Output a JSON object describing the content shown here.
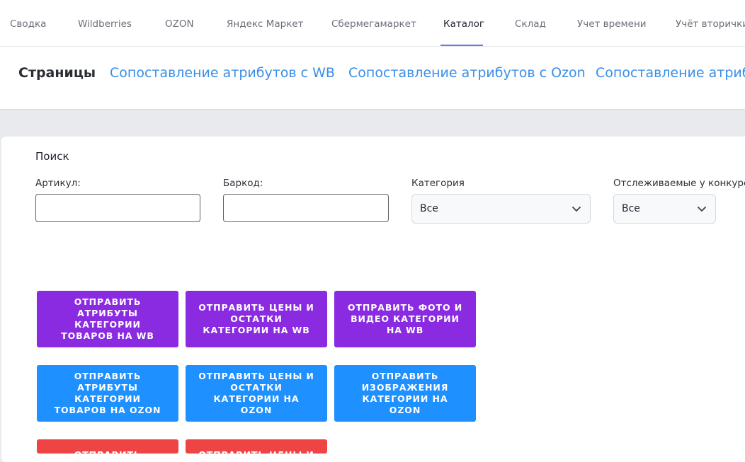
{
  "top_nav": {
    "tabs": [
      {
        "label": "Сводка",
        "active": false
      },
      {
        "label": "Wildberries",
        "active": false
      },
      {
        "label": "OZON",
        "active": false
      },
      {
        "label": "Яндекс Маркет",
        "active": false
      },
      {
        "label": "Сбермегамаркет",
        "active": false
      },
      {
        "label": "Каталог",
        "active": true
      },
      {
        "label": "Склад",
        "active": false
      },
      {
        "label": "Учет времени",
        "active": false
      },
      {
        "label": "Учёт вторички",
        "active": false
      }
    ],
    "active_underline_color": "#6e7bdc"
  },
  "sub_nav": {
    "title": "Страницы",
    "links": [
      "Сопоставление атрибутов с WB",
      "Сопоставление атрибутов с Ozon",
      "Сопоставление атрибу"
    ],
    "link_color": "#3a8ee8"
  },
  "search": {
    "title": "Поиск",
    "article_label": "Артикул:",
    "article_value": "",
    "barcode_label": "Баркод:",
    "barcode_value": "",
    "category_label": "Категория",
    "category_value": "Все",
    "tracked_label": "Отслеживаемые у конкурент",
    "tracked_value": "Все"
  },
  "actions": {
    "wb": [
      "Отправить атрибуты категории товаров на WB",
      "Отправить цены и остатки категории на WB",
      "Отправить фото и видео категории на WB"
    ],
    "ozon": [
      "Отправить атрибуты категории товаров на OZON",
      "Отправить цены и остатки категории на OZON",
      "Отправить изображения категории на OZON"
    ],
    "third_row": [
      "Отправить атрибуты",
      "Отправить цены и"
    ]
  },
  "colors": {
    "wb_button": "#8a2be2",
    "ozon_button": "#1e90ff",
    "third_row_button": "#ef4444"
  }
}
